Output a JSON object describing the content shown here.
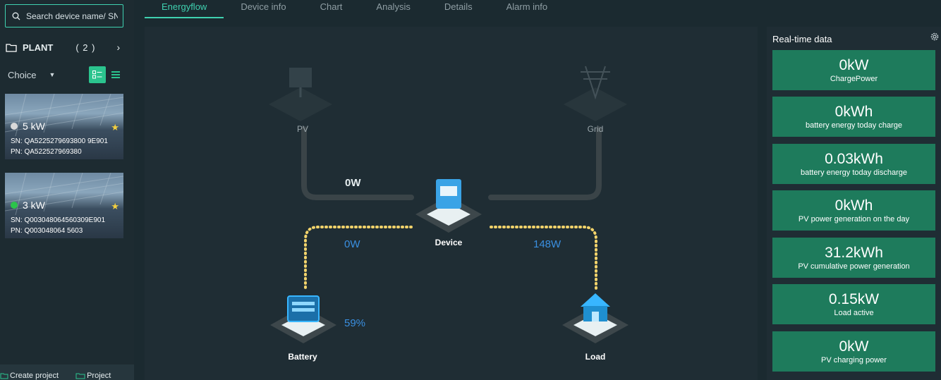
{
  "search": {
    "placeholder": "Search device name/ SN"
  },
  "plant": {
    "label": "PLANT",
    "count": "( 2 )"
  },
  "choice": {
    "label": "Choice"
  },
  "devices": [
    {
      "power": "5 kW",
      "status_color": "#d9d9d9",
      "sn": "SN: QA5225279693800 9E901",
      "pn": "PN: QA522527969380"
    },
    {
      "power": "3 kW",
      "status_color": "#2bc44a",
      "sn": "SN: Q003048064560309E901",
      "pn": "PN: Q003048064 5603"
    }
  ],
  "bottom": {
    "create": "Create project",
    "project": "Project"
  },
  "tabs": [
    "Energyflow",
    "Device info",
    "Chart",
    "Analysis",
    "Details",
    "Alarm info"
  ],
  "flow": {
    "pv_label": "PV",
    "grid_label": "Grid",
    "device_label": "Device",
    "battery_label": "Battery",
    "load_label": "Load",
    "pv_grid_power": "0W",
    "battery_power": "0W",
    "load_power": "148W",
    "battery_soc": "59%"
  },
  "realtime": {
    "title": "Real-time data",
    "cards": [
      {
        "value": "0kW",
        "label": "ChargePower"
      },
      {
        "value": "0kWh",
        "label": "battery energy today charge"
      },
      {
        "value": "0.03kWh",
        "label": "battery energy today discharge"
      },
      {
        "value": "0kWh",
        "label": "PV power generation on the day"
      },
      {
        "value": "31.2kWh",
        "label": "PV cumulative power generation"
      },
      {
        "value": "0.15kW",
        "label": "Load active"
      },
      {
        "value": "0kW",
        "label": "PV charging power"
      }
    ]
  },
  "colors": {
    "accent": "#3fd1b0",
    "card_green": "#1e7b5c",
    "flow_blue": "#3a8fe0",
    "dots": "#f2d36b"
  }
}
